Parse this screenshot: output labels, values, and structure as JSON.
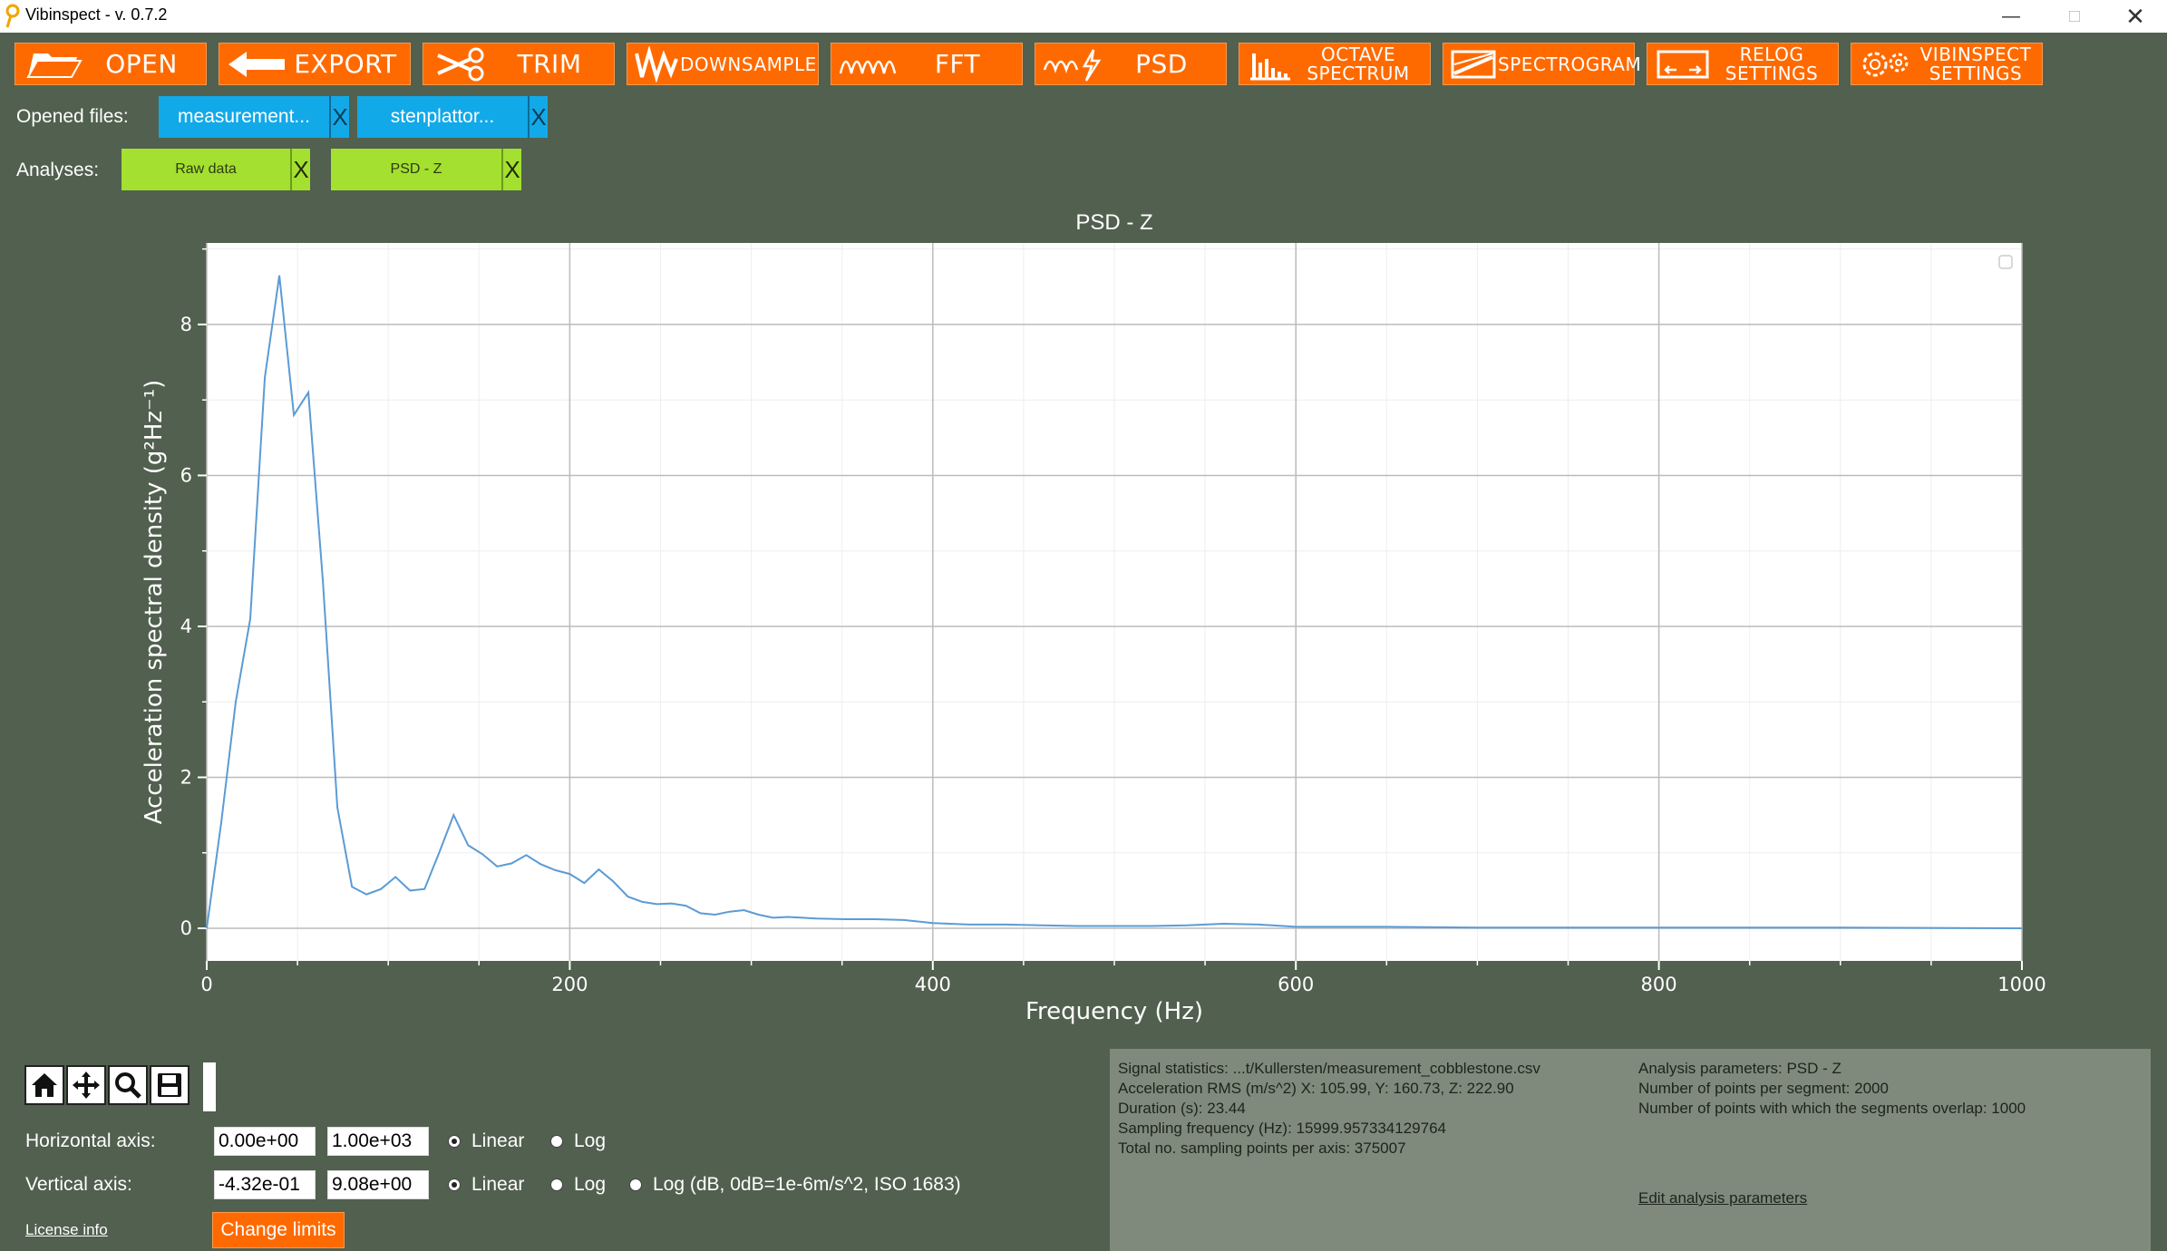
{
  "window": {
    "title": "Vibinspect - v. 0.7.2",
    "controls": [
      "minimize",
      "maximize",
      "close"
    ]
  },
  "toolbar": {
    "buttons": [
      {
        "label": "OPEN",
        "icon": "folder-icon"
      },
      {
        "label": "EXPORT",
        "icon": "arrow-left-icon"
      },
      {
        "label": "TRIM",
        "icon": "scissors-icon"
      },
      {
        "label": "DOWNSAMPLE",
        "icon": "downsample-wave-icon"
      },
      {
        "label": "FFT",
        "icon": "wave-icon"
      },
      {
        "label": "PSD",
        "icon": "wave-lightning-icon"
      },
      {
        "label": "OCTAVE\nSPECTRUM",
        "icon": "bar-chart-icon"
      },
      {
        "label": "SPECTROGRAM",
        "icon": "spectrogram-icon"
      },
      {
        "label": "RELOG\nSETTINGS",
        "icon": "relog-icon"
      },
      {
        "label": "VIBINSPECT\nSETTINGS",
        "icon": "gear-icon"
      }
    ]
  },
  "files": {
    "label": "Opened files:",
    "items": [
      {
        "name": "measurement...",
        "close": "X"
      },
      {
        "name": "stenplattor...",
        "close": "X"
      }
    ]
  },
  "analyses": {
    "label": "Analyses:",
    "items": [
      {
        "name": "Raw data",
        "close": "X"
      },
      {
        "name": "PSD - Z",
        "close": "X"
      }
    ]
  },
  "chart_data": {
    "type": "line",
    "title": "PSD - Z",
    "xlabel": "Frequency (Hz)",
    "ylabel": "Acceleration spectral density (g²Hz⁻¹)",
    "xlim": [
      0,
      1000
    ],
    "ylim": [
      -0.432,
      9.08
    ],
    "xticks": [
      0,
      200,
      400,
      600,
      800,
      1000
    ],
    "yticks": [
      0,
      2,
      4,
      6,
      8
    ],
    "grid": true,
    "color": "#5b9bd5",
    "series": [
      {
        "x": [
          0,
          8,
          16,
          24,
          32,
          40,
          48,
          56,
          64,
          72,
          80,
          88,
          96,
          104,
          112,
          120,
          128,
          136,
          144,
          152,
          160,
          168,
          176,
          184,
          192,
          200,
          208,
          216,
          224,
          232,
          240,
          248,
          256,
          264,
          272,
          280,
          288,
          296,
          304,
          312,
          320,
          336,
          352,
          368,
          384,
          400,
          420,
          440,
          460,
          480,
          500,
          520,
          540,
          560,
          580,
          600,
          650,
          700,
          800,
          900,
          1000
        ],
        "y": [
          0.0,
          1.4,
          3.0,
          4.1,
          7.3,
          8.65,
          6.8,
          7.1,
          4.6,
          1.6,
          0.55,
          0.45,
          0.52,
          0.68,
          0.5,
          0.52,
          1.0,
          1.5,
          1.1,
          0.98,
          0.82,
          0.86,
          0.97,
          0.85,
          0.77,
          0.72,
          0.6,
          0.78,
          0.62,
          0.42,
          0.35,
          0.32,
          0.33,
          0.3,
          0.2,
          0.18,
          0.22,
          0.24,
          0.18,
          0.14,
          0.15,
          0.13,
          0.12,
          0.12,
          0.11,
          0.07,
          0.05,
          0.05,
          0.04,
          0.03,
          0.03,
          0.03,
          0.04,
          0.06,
          0.05,
          0.02,
          0.02,
          0.01,
          0.01,
          0.01,
          0.0
        ]
      }
    ]
  },
  "nav_toolbar": {
    "buttons": [
      {
        "icon": "home-icon"
      },
      {
        "icon": "pan-icon"
      },
      {
        "icon": "zoom-icon"
      },
      {
        "icon": "save-icon"
      }
    ]
  },
  "limits": {
    "horizontal": {
      "label": "Horizontal axis:",
      "min": "0.00e+00",
      "max": "1.00e+03",
      "options": [
        {
          "label": "Linear",
          "selected": true
        },
        {
          "label": "Log",
          "selected": false
        }
      ]
    },
    "vertical": {
      "label": "Vertical axis:",
      "min": "-4.32e-01",
      "max": "9.08e+00",
      "options": [
        {
          "label": "Linear",
          "selected": true
        },
        {
          "label": "Log",
          "selected": false
        },
        {
          "label": "Log (dB, 0dB=1e-6m/s^2, ISO 1683)",
          "selected": false
        }
      ]
    },
    "change_button": "Change limits"
  },
  "license_link": "License info",
  "info": {
    "signal_stats": [
      "Signal statistics: ...t/Kullersten/measurement_cobblestone.csv",
      "Acceleration RMS (m/s^2) X: 105.99, Y: 160.73, Z: 222.90",
      "Duration (s): 23.44",
      "Sampling frequency (Hz): 15999.957334129764",
      "Total no. sampling points per axis: 375007"
    ],
    "analysis_params": [
      "Analysis parameters: PSD - Z",
      "Number of points per segment: 2000",
      "Number of points with which the segments overlap: 1000"
    ],
    "edit_link": "Edit analysis parameters"
  },
  "colors": {
    "background": "#52604f",
    "accent": "#ff6a00",
    "file_chip": "#12a9e9",
    "analysis_chip": "#a4e02f",
    "info_panel": "#7f8a7c"
  }
}
